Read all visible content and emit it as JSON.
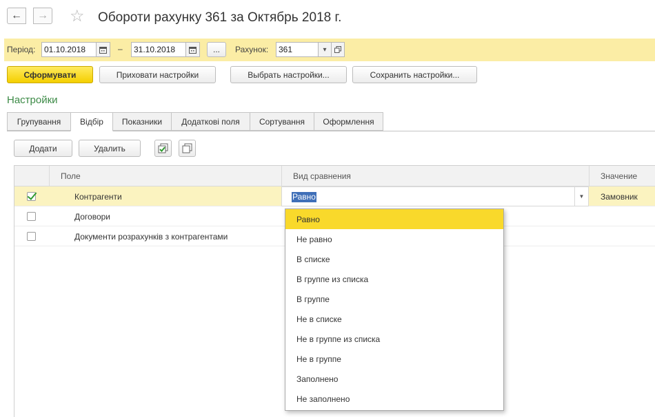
{
  "title": "Обороти рахунку 361 за Октябрь 2018 г.",
  "nav": {
    "back_glyph": "←",
    "forward_glyph": "→",
    "star_glyph": "☆"
  },
  "period": {
    "label": "Період:",
    "from": "01.10.2018",
    "dash": "–",
    "to": "31.10.2018",
    "more": "...",
    "account_label": "Рахунок:",
    "account_value": "361"
  },
  "buttons": {
    "generate": "Сформувати",
    "hide_settings": "Приховати настройки",
    "choose_settings": "Выбрать настройки...",
    "save_settings": "Сохранить настройки..."
  },
  "settings_title": "Настройки",
  "tabs": [
    {
      "label": "Групування"
    },
    {
      "label": "Відбір"
    },
    {
      "label": "Показники"
    },
    {
      "label": "Додаткові поля"
    },
    {
      "label": "Сортування"
    },
    {
      "label": "Оформлення"
    }
  ],
  "filter_buttons": {
    "add": "Додати",
    "remove": "Удалить"
  },
  "grid": {
    "columns": {
      "field": "Поле",
      "comparison": "Вид сравнения",
      "value": "Значение"
    },
    "rows": [
      {
        "checked": true,
        "field": "Контрагенти",
        "comparison": "Равно",
        "value": "Замовник"
      },
      {
        "checked": false,
        "field": "Договори",
        "comparison": "",
        "value": ""
      },
      {
        "checked": false,
        "field": "Документи розрахунків з контрагентами",
        "comparison": "",
        "value": ""
      }
    ]
  },
  "dropdown_options": [
    "Равно",
    "Не равно",
    "В списке",
    "В группе из списка",
    "В группе",
    "Не в списке",
    "Не в группе из списка",
    "Не в группе",
    "Заполнено",
    "Не заполнено"
  ],
  "colors": {
    "period_bar": "#fbeda5",
    "primary_button": "#f4cf00",
    "selected_row": "#fbf3c0",
    "highlight_option": "#f9d92b",
    "settings_title": "#3c8a46"
  }
}
